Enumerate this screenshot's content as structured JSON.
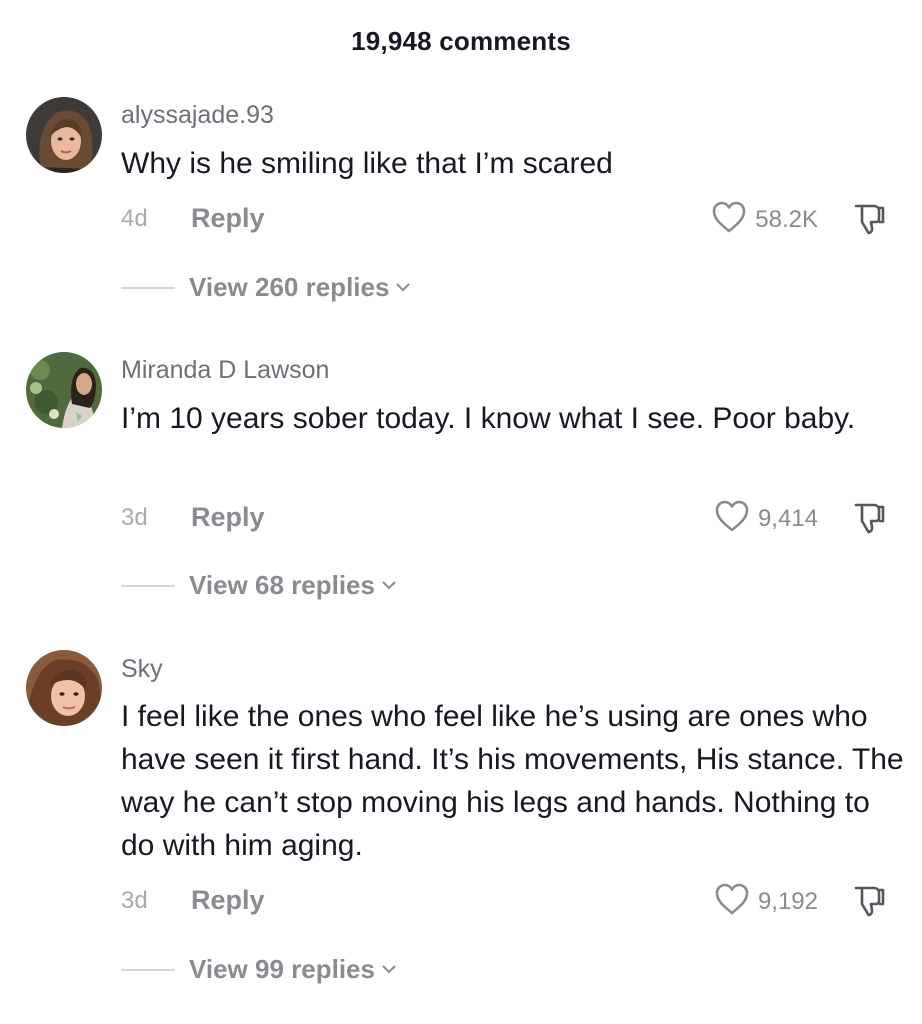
{
  "header": {
    "title": "19,948 comments"
  },
  "comments": [
    {
      "username": "alyssajade.93",
      "text": "Why is he smiling like that I’m scared",
      "age": "4d",
      "reply_label": "Reply",
      "likes": "58.2K",
      "view_replies_label": "View 260 replies",
      "avatar_icon": "avatar-photo"
    },
    {
      "username": "Miranda D Lawson",
      "text": "I’m 10 years sober today. I know what I see. Poor baby.",
      "age": "3d",
      "reply_label": "Reply",
      "likes": "9,414",
      "view_replies_label": "View 68 replies",
      "avatar_icon": "avatar-photo"
    },
    {
      "username": "Sky",
      "text": "I feel like the ones who feel like he’s using are ones who have seen it first hand. It’s his movements, His stance. The way he can’t stop moving his legs and hands. Nothing to do with him aging.",
      "age": "3d",
      "reply_label": "Reply",
      "likes": "9,192",
      "view_replies_label": "View 99 replies",
      "avatar_icon": "avatar-photo"
    }
  ],
  "icons": {
    "like": "heart-outline-icon",
    "dislike": "thumbs-down-outline-icon",
    "expand": "chevron-down-icon"
  },
  "colors": {
    "text_primary": "#161823",
    "text_secondary": "#8a8b91",
    "text_muted": "#a8a9ad"
  }
}
